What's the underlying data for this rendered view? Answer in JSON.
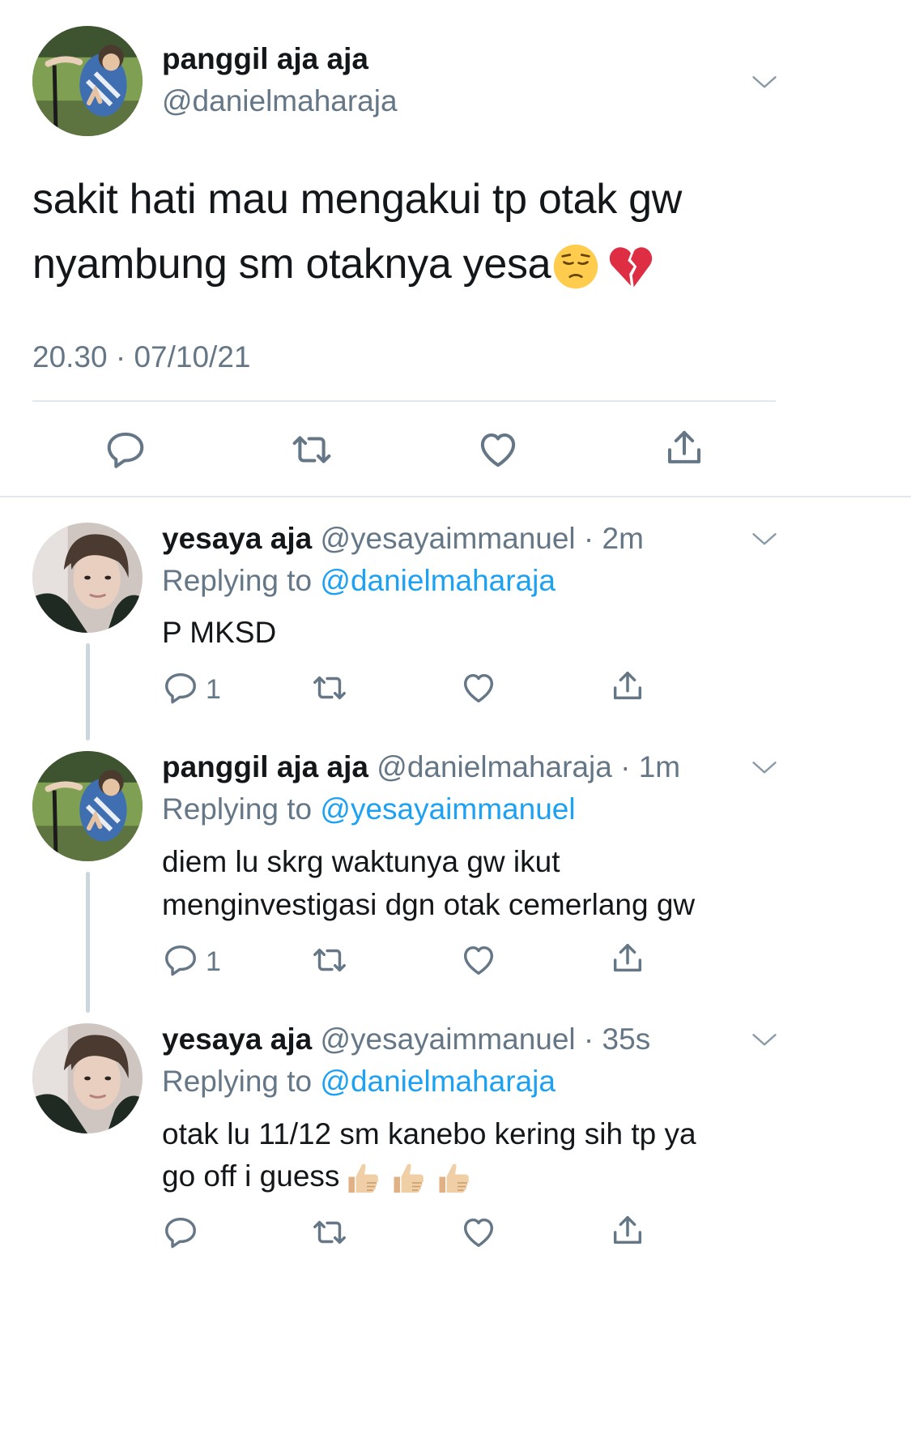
{
  "main_tweet": {
    "author_name": "panggil aja aja",
    "author_handle": "@danielmaharaja",
    "text_line1": "sakit hati mau mengakui tp otak gw",
    "text_line2": "nyambung sm otaknya yesa",
    "timestamp": "20.30 · 07/10/21",
    "emojis": [
      "pensive-face",
      "broken-heart"
    ]
  },
  "replies": [
    {
      "author_name": "yesaya aja",
      "author_handle": "@yesayaimmanuel",
      "time": "2m",
      "replying_label": "Replying to",
      "replying_to": "@danielmaharaja",
      "text_line1": "P MKSD",
      "text_line2": "",
      "reply_count": "1"
    },
    {
      "author_name": "panggil aja aja",
      "author_handle": "@danielmaharaja",
      "time": "1m",
      "replying_label": "Replying to",
      "replying_to": "@yesayaimmanuel",
      "text_line1": "diem lu skrg waktunya gw ikut",
      "text_line2": "menginvestigasi dgn otak cemerlang gw",
      "reply_count": "1"
    },
    {
      "author_name": "yesaya aja",
      "author_handle": "@yesayaimmanuel",
      "time": "35s",
      "replying_label": "Replying to",
      "replying_to": "@danielmaharaja",
      "text_line1": "otak lu 11/12 sm kanebo kering sih tp ya",
      "text_line2": "go off i guess",
      "reply_count": "",
      "emojis": [
        "thumbs-up",
        "thumbs-up",
        "thumbs-up"
      ]
    }
  ],
  "colors": {
    "text": "#14171a",
    "muted": "#657786",
    "link": "#1da1f2",
    "divider": "#e1e8ed",
    "thread_line": "#ccd6dd"
  }
}
